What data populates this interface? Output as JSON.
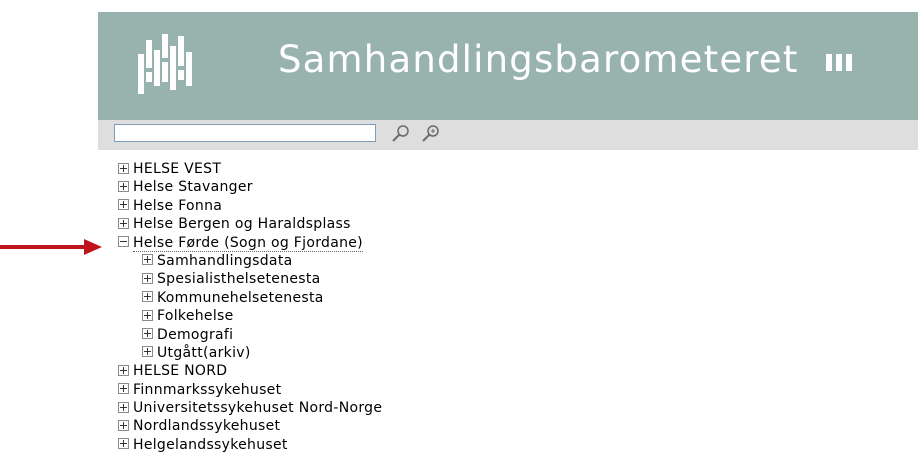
{
  "header": {
    "title": "Samhandlingsbarometeret"
  },
  "toolbar": {
    "search_value": "",
    "icons": [
      "search-icon",
      "zoom-in-icon"
    ]
  },
  "tree": {
    "items": [
      {
        "label": "HELSE VEST",
        "state": "collapsed",
        "level": 0
      },
      {
        "label": "Helse Stavanger",
        "state": "collapsed",
        "level": 0
      },
      {
        "label": "Helse Fonna",
        "state": "collapsed",
        "level": 0
      },
      {
        "label": "Helse Bergen og Haraldsplass",
        "state": "collapsed",
        "level": 0
      },
      {
        "label": "Helse Førde (Sogn og Fjordane)",
        "state": "expanded",
        "level": 0
      },
      {
        "label": "Samhandlingsdata",
        "state": "collapsed",
        "level": 1
      },
      {
        "label": "Spesialisthelsetenesta",
        "state": "collapsed",
        "level": 1
      },
      {
        "label": "Kommunehelsetenesta",
        "state": "collapsed",
        "level": 1
      },
      {
        "label": "Folkehelse",
        "state": "collapsed",
        "level": 1
      },
      {
        "label": "Demografi",
        "state": "collapsed",
        "level": 1
      },
      {
        "label": "Utgått(arkiv)",
        "state": "collapsed",
        "level": 1
      },
      {
        "label": "HELSE NORD",
        "state": "collapsed",
        "level": 0
      },
      {
        "label": "Finnmarkssykehuset",
        "state": "collapsed",
        "level": 0
      },
      {
        "label": "Universitetssykehuset Nord-Norge",
        "state": "collapsed",
        "level": 0
      },
      {
        "label": "Nordlandssykehuset",
        "state": "collapsed",
        "level": 0
      },
      {
        "label": "Helgelandssykehuset",
        "state": "collapsed",
        "level": 0
      }
    ]
  },
  "annotation": {
    "icon": "arrow-right-icon",
    "color": "#c0141c"
  },
  "colors": {
    "banner": "#98b3ae",
    "toolbar": "#dedede"
  }
}
